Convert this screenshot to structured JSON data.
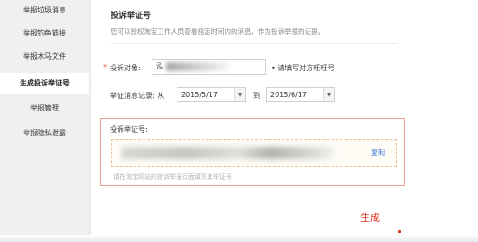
{
  "sidebar": {
    "items": [
      {
        "label": "举报垃圾消息",
        "active": false
      },
      {
        "label": "举报钓鱼链接",
        "active": false
      },
      {
        "label": "举报木马文件",
        "active": false
      },
      {
        "label": "生成投诉举证号",
        "active": true
      },
      {
        "label": "举报管理",
        "active": false
      },
      {
        "label": "举报隐私泄露",
        "active": false
      }
    ]
  },
  "main": {
    "title": "投诉举证号",
    "description": "您可以授权淘宝工作人员查看指定时间内的消息，作为投诉举报的证据。",
    "object": {
      "required_mark": "*",
      "label": "投诉对象:",
      "value": "泓",
      "hint": "• 请填写对方旺旺号"
    },
    "record": {
      "label": "举证消息记录: 从",
      "from_date": "2015/5/17",
      "to_label": "到",
      "to_date": "2015/6/17"
    },
    "cert_panel": {
      "title": "投诉举证号:",
      "copy_label": "复制",
      "hint": "请在淘宝网站的投诉举报页面填写此举证号"
    },
    "generate_label": "生成"
  }
}
